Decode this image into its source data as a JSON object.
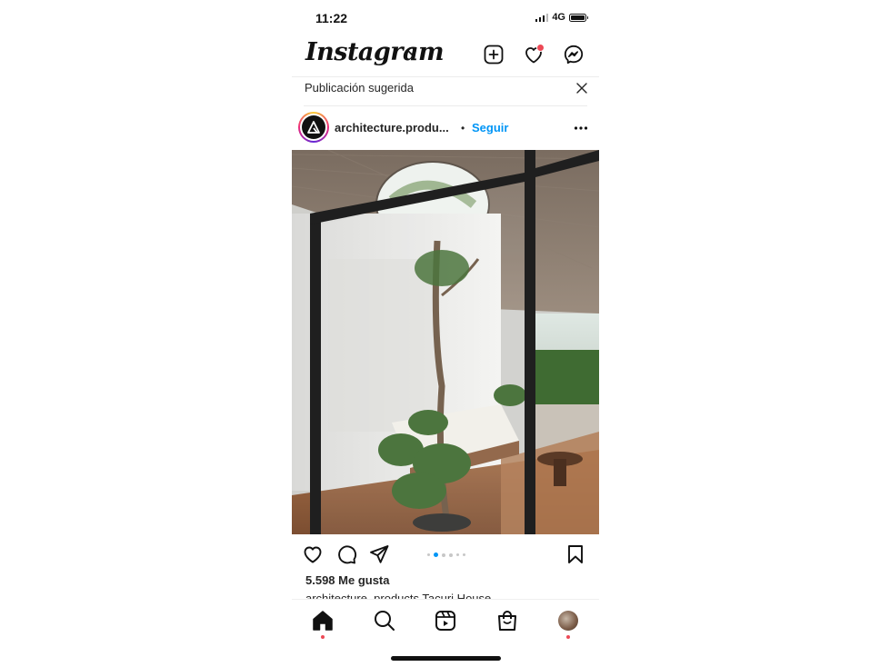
{
  "status_bar": {
    "time": "11:22",
    "network": "4G"
  },
  "header": {
    "logo": "Instagram",
    "icons": [
      "chevron-down-icon",
      "new-post-icon",
      "activity-heart-icon",
      "messenger-icon"
    ],
    "notification_dot_color": "#ed4956"
  },
  "suggestion": {
    "label": "Publicación sugerida"
  },
  "post": {
    "username": "architecture.produ...",
    "separator": "•",
    "follow_label": "Seguir",
    "carousel": {
      "count": 6,
      "active_index": 1
    },
    "likes": "5.598 Me gusta",
    "caption": "architecture_products Tacuri House"
  },
  "bottom_nav": {
    "items": [
      "home",
      "search",
      "reels",
      "shop",
      "profile"
    ],
    "active": "home"
  },
  "colors": {
    "accent_blue": "#0095f6",
    "notification_red": "#ed4956",
    "text": "#262626"
  }
}
